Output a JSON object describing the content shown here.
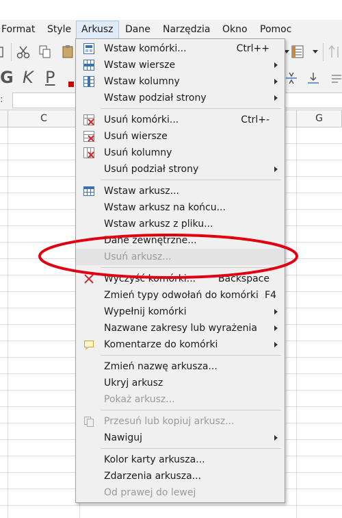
{
  "menubar": {
    "items": [
      "Format",
      "Style",
      "Arkusz",
      "Dane",
      "Narzędzia",
      "Okno",
      "Pomoc"
    ]
  },
  "toolbar2": {
    "bold": "G",
    "italic": "K",
    "underline": "P"
  },
  "columns": [
    "C",
    "G"
  ],
  "menu": {
    "items": [
      {
        "label": "Wstaw komórki...",
        "shortcut": "Ctrl++"
      },
      {
        "label": "Wstaw wiersze"
      },
      {
        "label": "Wstaw kolumny"
      },
      {
        "label": "Wstaw podział strony"
      },
      {
        "label": "Usuń komórki...",
        "shortcut": "Ctrl+-"
      },
      {
        "label": "Usuń wiersze"
      },
      {
        "label": "Usuń kolumny"
      },
      {
        "label": "Usuń podział strony"
      },
      {
        "label": "Wstaw arkusz..."
      },
      {
        "label": "Wstaw arkusz na końcu..."
      },
      {
        "label": "Wstaw arkusz z pliku..."
      },
      {
        "label": "Dane zewnętrzne..."
      },
      {
        "label": "Usuń arkusz..."
      },
      {
        "label": "Wyczyść komórki...",
        "shortcut": "Backspace"
      },
      {
        "label": "Zmień typy odwołań do komórki",
        "shortcut": "F4"
      },
      {
        "label": "Wypełnij komórki"
      },
      {
        "label": "Nazwane zakresy lub wyrażenia"
      },
      {
        "label": "Komentarze do komórki"
      },
      {
        "label": "Zmień nazwę arkusza..."
      },
      {
        "label": "Ukryj arkusz"
      },
      {
        "label": "Pokaż arkusz..."
      },
      {
        "label": "Przesuń lub kopiuj arkusz..."
      },
      {
        "label": "Nawiguj"
      },
      {
        "label": "Kolor karty arkusza..."
      },
      {
        "label": "Zdarzenia arkusza..."
      },
      {
        "label": "Od prawej do lewej"
      }
    ]
  },
  "annotation": {
    "color": "#e0000f"
  }
}
